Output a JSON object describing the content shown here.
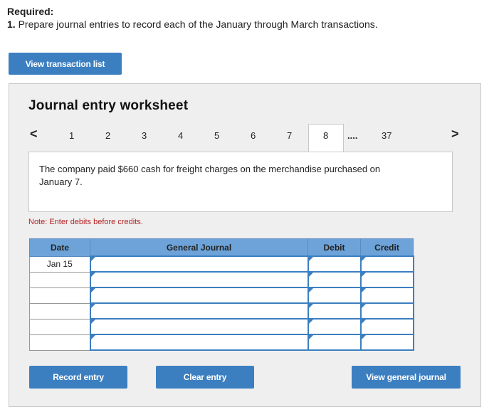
{
  "header": {
    "required": "Required:",
    "instruction_num": "1.",
    "instruction_text": " Prepare journal entries to record each of the January through March transactions."
  },
  "view_transaction_list_label": "View transaction list",
  "worksheet": {
    "title": "Journal entry worksheet",
    "nav": {
      "prev_icon": "chevron-left-icon",
      "next_icon": "chevron-right-icon",
      "pages": [
        "1",
        "2",
        "3",
        "4",
        "5",
        "6",
        "7",
        "8"
      ],
      "current": "8",
      "ellipsis": "....",
      "last": "37"
    },
    "description": "The company paid $660 cash for freight charges on the merchandise purchased on January 7.",
    "note": "Note: Enter debits before credits.",
    "table": {
      "headers": [
        "Date",
        "General Journal",
        "Debit",
        "Credit"
      ],
      "rows": [
        {
          "date": "Jan 15",
          "account": "",
          "debit": "",
          "credit": ""
        },
        {
          "date": "",
          "account": "",
          "debit": "",
          "credit": ""
        },
        {
          "date": "",
          "account": "",
          "debit": "",
          "credit": ""
        },
        {
          "date": "",
          "account": "",
          "debit": "",
          "credit": ""
        },
        {
          "date": "",
          "account": "",
          "debit": "",
          "credit": ""
        },
        {
          "date": "",
          "account": "",
          "debit": "",
          "credit": ""
        }
      ]
    },
    "buttons": {
      "record": "Record entry",
      "clear": "Clear entry",
      "view_journal": "View general journal"
    }
  },
  "colors": {
    "accent": "#3c7fc1",
    "header_fill": "#6da3d8",
    "panel_bg": "#efefef",
    "note": "#b22222"
  }
}
